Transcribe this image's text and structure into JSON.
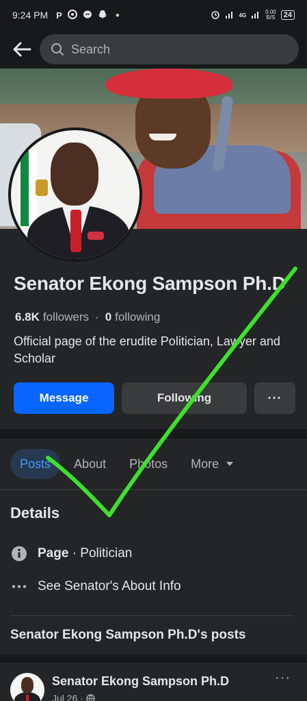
{
  "status_bar": {
    "time": "9:24 PM",
    "notification_icons": [
      "P",
      "whatsapp-icon",
      "messenger-icon",
      "snapchat-icon"
    ],
    "network": "4G",
    "speed_value": "0.00",
    "speed_unit": "B/S",
    "battery": "24"
  },
  "search": {
    "placeholder": "Search"
  },
  "profile": {
    "name": "Senator Ekong Sampson Ph.D",
    "followers_count": "6.8K",
    "followers_label": "followers",
    "separator": "·",
    "following_count": "0",
    "following_label": "following",
    "bio": "Official page of the erudite Politician, Lawyer and Scholar"
  },
  "actions": {
    "message_label": "Message",
    "following_label": "Following",
    "more_label": "···"
  },
  "tabs": [
    {
      "label": "Posts",
      "active": true
    },
    {
      "label": "About",
      "active": false
    },
    {
      "label": "Photos",
      "active": false
    },
    {
      "label": "More",
      "active": false
    }
  ],
  "details": {
    "title": "Details",
    "page_type_bold": "Page",
    "page_type_rest": " · Politician",
    "about_link": "See Senator's About Info"
  },
  "posts_section": {
    "title": "Senator Ekong Sampson Ph.D's posts"
  },
  "post": {
    "author": "Senator Ekong Sampson Ph.D",
    "date": "Jul 26 ·",
    "more_label": "···"
  },
  "colors": {
    "background": "#242526",
    "header": "#18191a",
    "primary_blue": "#0866ff",
    "active_tab_bg": "#263951",
    "active_tab_text": "#4599ff",
    "checkmark": "#3ee02c"
  }
}
